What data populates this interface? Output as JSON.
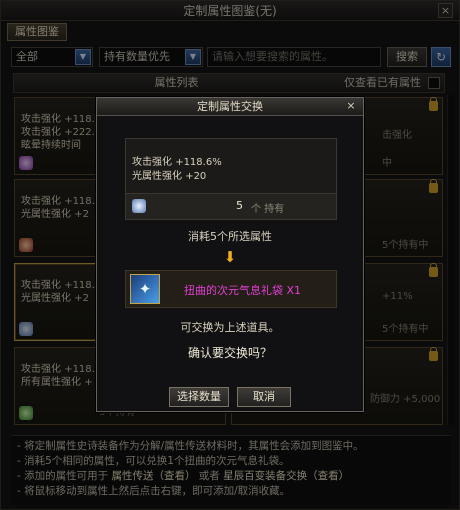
{
  "window": {
    "title": "定制属性图鉴(无)",
    "close": "×"
  },
  "tab": {
    "label": "属性图鉴"
  },
  "toolbar": {
    "filter_dd": "全部",
    "sort_dd": "持有数量优先",
    "search_placeholder": "请输入想要搜索的属性。",
    "search_button": "搜索",
    "refresh_icon": "↻"
  },
  "list": {
    "title": "属性列表",
    "owned_only_label": "仅查看已有属性",
    "cards": [
      {
        "line1_name": "攻击强化",
        "line1_val": "+118.6",
        "line2_name": "攻击强化",
        "line2_val": "+222.3",
        "line3": "眩晕持续时间",
        "count": ""
      },
      {
        "line1_name": "攻击强化",
        "line1_val": "+118.6",
        "line2_name": "光属性强化",
        "line2_val": "+2",
        "line3": "",
        "count": "5个"
      },
      {
        "line1_name": "攻击强化",
        "line1_val": "+118.6",
        "line2_name": "光属性强化",
        "line2_val": "+2",
        "line3": "",
        "count": ""
      },
      {
        "line1_name": "攻击强化",
        "line1_val": "+118.6",
        "line2_name": "所有属性强化",
        "line2_val": "+",
        "line3": "",
        "count": "5个持有"
      }
    ],
    "right_fragments": {
      "r0": "击强化",
      "r1": "中",
      "r2": "5个持有中",
      "r3": "+11%",
      "r4": "5个持有中",
      "r5": "防御力 +5,000"
    }
  },
  "notes": [
    {
      "text": "- 将定制属性史诗装备作为分解/属性传送材料时，其属性会添加到图鉴中。"
    },
    {
      "text": "- 消耗5个相同的属性，可以兑换1个扭曲的次元气息礼袋。"
    },
    {
      "pre": "- 添加的属性可用于 ",
      "link1": "属性传送（查看）",
      "mid": " 或者 ",
      "link2": "星辰百变装备交换（查看）"
    },
    {
      "text": "- 将鼠标移动到属性上然后点击右键，即可添加/取消收藏。"
    }
  ],
  "modal": {
    "title": "定制属性交换",
    "close": "×",
    "attr_line1_name": "攻击强化",
    "attr_line1_val": "+118.6%",
    "attr_line2_name": "光属性强化",
    "attr_line2_val": "+20",
    "count": "5",
    "count_unit": "个 持有",
    "consume_text": "消耗5个所选属性",
    "reward_name": "扭曲的次元气息礼袋 X1",
    "exchange_text": "可交换为上述道具。",
    "confirm_text": "确认要交换吗？",
    "select_button": "选择数量",
    "cancel_button": "取消"
  },
  "colors": {
    "accent_blue": "#3c6aa8",
    "reward_name": "#e33fd8",
    "lock": "#d4a22a",
    "highlight_border": "#c8a24a"
  }
}
